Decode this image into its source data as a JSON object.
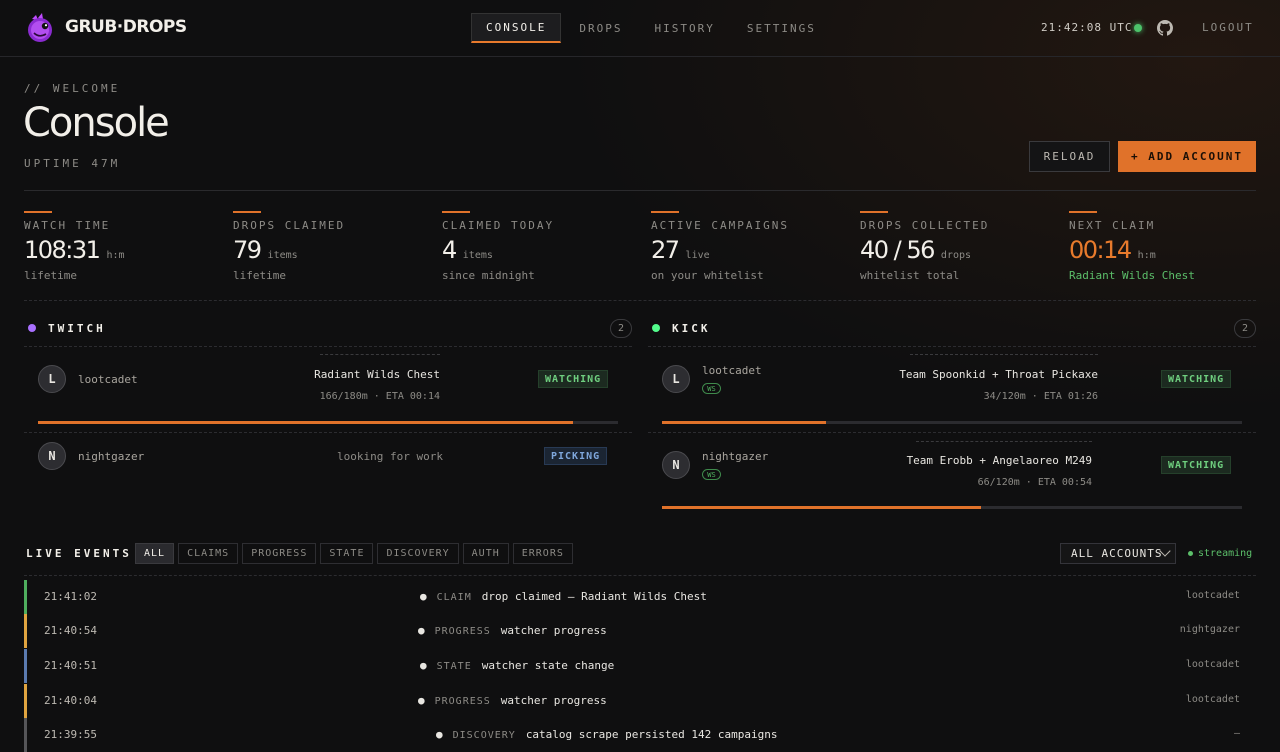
{
  "brand": {
    "name": "GRUB·DROPS"
  },
  "nav": {
    "tabs": [
      "CONSOLE",
      "DROPS",
      "HISTORY",
      "SETTINGS"
    ],
    "active": "CONSOLE"
  },
  "header": {
    "clock": "21:42:08 UTC",
    "logout": "LOGOUT"
  },
  "page": {
    "eyebrow": "// WELCOME",
    "title": "Console",
    "uptime": "UPTIME 47M"
  },
  "actions": {
    "reload": "RELOAD",
    "add_account": "+ ADD ACCOUNT"
  },
  "stats": [
    {
      "label": "WATCH TIME",
      "value": "108:31",
      "unit": "h:m",
      "sub": "lifetime"
    },
    {
      "label": "DROPS CLAIMED",
      "value": "79",
      "unit": "items",
      "sub": "lifetime"
    },
    {
      "label": "CLAIMED TODAY",
      "value": "4",
      "unit": "items",
      "sub": "since midnight"
    },
    {
      "label": "ACTIVE CAMPAIGNS",
      "value": "27",
      "unit": "live",
      "sub": "on your whitelist"
    },
    {
      "label": "DROPS COLLECTED",
      "value": "40 / 56",
      "unit": "drops",
      "sub": "whitelist total"
    },
    {
      "label": "NEXT CLAIM",
      "value": "00:14",
      "unit": "h:m",
      "sub": "Radiant Wilds Chest"
    }
  ],
  "twitch": {
    "name": "TWITCH",
    "count": "2",
    "color": "#a970ff",
    "rows": [
      {
        "initial": "L",
        "account": "lootcadet",
        "campaign": "Radiant Wilds Chest",
        "meta": "166/180m · ETA 00:14",
        "status": "WATCHING",
        "progress": 0.922
      },
      {
        "initial": "N",
        "account": "nightgazer",
        "campaign": "looking for work",
        "status": "PICKING"
      }
    ]
  },
  "kick": {
    "name": "KICK",
    "count": "2",
    "color": "#53fc8c",
    "rows": [
      {
        "initial": "L",
        "account": "lootcadet",
        "badge": "WS",
        "campaign": "Team Spoonkid + Throat Pickaxe",
        "meta": "34/120m · ETA 01:26",
        "status": "WATCHING",
        "progress": 0.283
      },
      {
        "initial": "N",
        "account": "nightgazer",
        "badge": "WS",
        "campaign": "Team Erobb + Angelaoreo M249",
        "meta": "66/120m · ETA 00:54",
        "status": "WATCHING",
        "progress": 0.55
      }
    ]
  },
  "events": {
    "title": "LIVE EVENTS",
    "filters": [
      "ALL",
      "CLAIMS",
      "PROGRESS",
      "STATE",
      "DISCOVERY",
      "AUTH",
      "ERRORS"
    ],
    "active_filter": "ALL",
    "account_filter": "ALL ACCOUNTS",
    "streaming": "streaming",
    "items": [
      {
        "time": "21:41:02",
        "type": "CLAIM",
        "message": "drop claimed — Radiant Wilds Chest",
        "account": "lootcadet",
        "color": "#4fae5e"
      },
      {
        "time": "21:40:54",
        "type": "PROGRESS",
        "message": "watcher progress",
        "account": "nightgazer",
        "color": "#e0a440"
      },
      {
        "time": "21:40:51",
        "type": "STATE",
        "message": "watcher state change",
        "account": "lootcadet",
        "color": "#5b7bb0"
      },
      {
        "time": "21:40:04",
        "type": "PROGRESS",
        "message": "watcher progress",
        "account": "lootcadet",
        "color": "#e0a440"
      },
      {
        "time": "21:39:55",
        "type": "DISCOVERY",
        "message": "catalog scrape persisted 142 campaigns",
        "account": "—",
        "color": "#555558"
      }
    ]
  }
}
